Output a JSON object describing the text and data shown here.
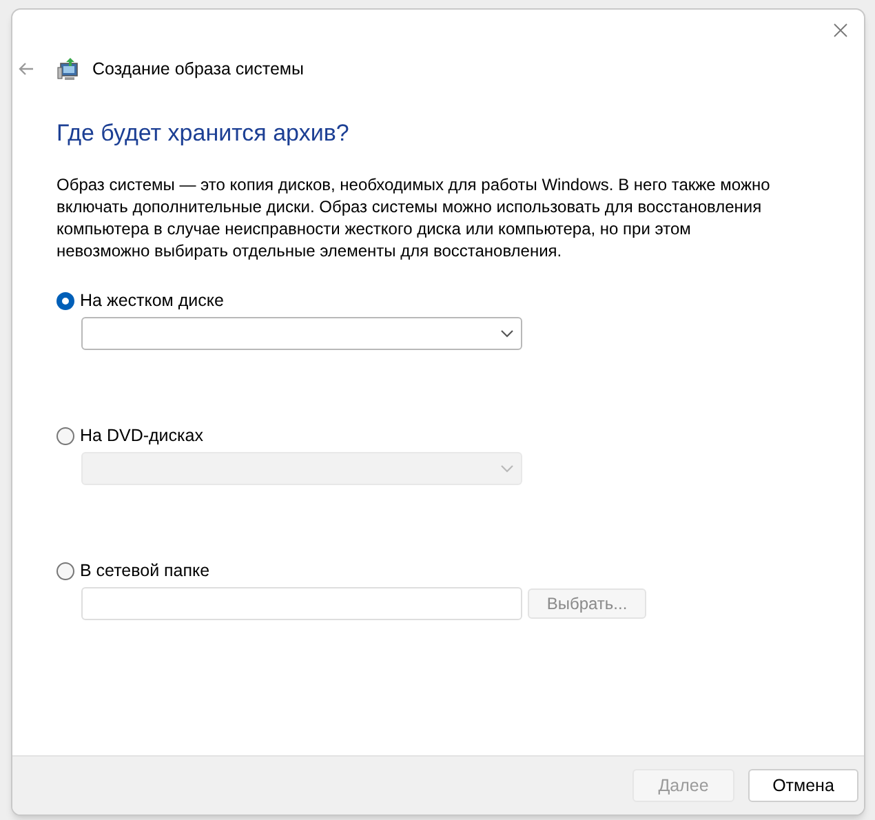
{
  "window": {
    "title": "Создание образа системы"
  },
  "heading": "Где будет хранится архив?",
  "description": "Образ системы — это копия дисков, необходимых для работы Windows. В него также можно включать дополнительные диски. Образ системы можно использовать для восстановления компьютера в случае неисправности жесткого диска или компьютера, но при этом невозможно выбирать отдельные элементы для восстановления.",
  "options": [
    {
      "label": "На жестком диске",
      "selected": true,
      "kind": "dropdown",
      "disabled": false
    },
    {
      "label": "На DVD-дисках",
      "selected": false,
      "kind": "dropdown",
      "disabled": true
    },
    {
      "label": "В сетевой папке",
      "selected": false,
      "kind": "path",
      "disabled": false,
      "browse": {
        "label": "Выбрать...",
        "disabled": true
      }
    }
  ],
  "buttons": [
    {
      "label": "Далее",
      "disabled": true
    },
    {
      "label": "Отмена",
      "disabled": false
    }
  ]
}
